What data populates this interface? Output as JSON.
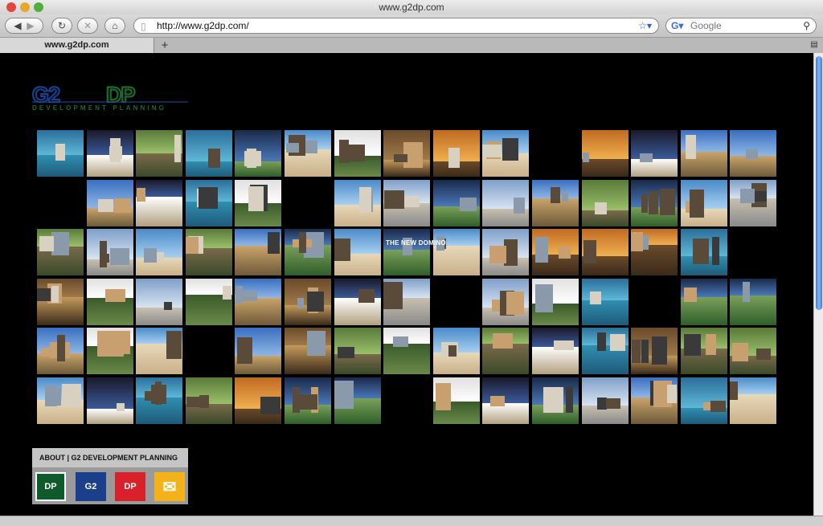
{
  "window": {
    "title": "www.g2dp.com"
  },
  "toolbar": {
    "address": "http://www.g2dp.com/",
    "search_placeholder": "Google"
  },
  "tabs": [
    {
      "label": "www.g2dp.com"
    }
  ],
  "logo": {
    "text": "G2DP",
    "subtitle": "DEVELOPMENT PLANNING"
  },
  "gallery": {
    "hover_label": "THE NEW DOMINO"
  },
  "about": {
    "title": "ABOUT | G2 DEVELOPMENT PLANNING",
    "buttons": [
      {
        "name": "dp-button",
        "label": "DP",
        "color": "#0f5a2a"
      },
      {
        "name": "g2-button",
        "label": "G2",
        "color": "#1c3f8c"
      },
      {
        "name": "news-button",
        "label": "DP",
        "color": "#d8212a"
      },
      {
        "name": "mail-button",
        "label": "✉",
        "color": "#f3b21a"
      }
    ]
  },
  "colors": {
    "page_bg": "#000000",
    "logo_blue": "#1c3f8c",
    "logo_green": "#1c6b2e"
  }
}
